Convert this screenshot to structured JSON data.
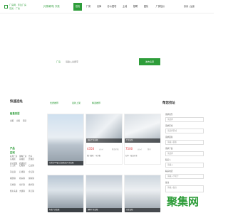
{
  "header": {
    "logo_text": "厂房网 · 专注厂房",
    "logo_sub": "东莞 · 厂房",
    "city": "[切换城市] 东莞",
    "nav": [
      "首页",
      "厂房",
      "仓库",
      "办公居宅",
      "土地",
      "招聘",
      "团队",
      "厂房估价"
    ],
    "active_nav": 0,
    "login": "登录 | 注册"
  },
  "search": {
    "label": "厂房",
    "placeholder": "请输入关键字",
    "button": "发布房源"
  },
  "left": {
    "title": "快速选址",
    "groups": [
      {
        "name": "租售类型",
        "links": [
          "出租",
          "出售",
          "租赁"
        ]
      },
      {
        "name": "产品",
        "links": [
          "标准厂房",
          "钢构厂房",
          "仓库",
          "办公研发",
          "商铺综合"
        ]
      },
      {
        "name": "区域",
        "links": [
          "东城区",
          "南城区",
          "莞城区",
          "万江区",
          "石碣镇",
          "石龙镇",
          "茶山镇",
          "石排镇",
          "企石镇",
          "横沥镇",
          "桥头镇",
          "谢岗镇",
          "东坑镇",
          "常平镇",
          "寮步镇",
          "樟木头镇",
          "大朗镇",
          "黄江镇"
        ]
      }
    ]
  },
  "tabs": [
    "优质推荐",
    "最新上架",
    "精选推荐"
  ],
  "cards_top": [
    {
      "caption": "东莞市XX镇工业园标准厂房出租",
      "price": "",
      "unit": ""
    },
    {
      "caption": "独栋厂房出租",
      "price": "4350",
      "unit": "元/㎡",
      "label": "租金价格",
      "tags": "独门独院 · 可分租"
    },
    {
      "caption": "厂房出售",
      "price": "7500",
      "unit": "元/㎡",
      "label": "售价",
      "tags": "红本 · 双证齐全"
    }
  ],
  "cards_bottom": [
    {
      "caption": "标准厂房出租"
    },
    {
      "caption": "钢构厂房出租"
    },
    {
      "caption": "仓库出租"
    }
  ],
  "right": {
    "title": "帮您找址",
    "fields": [
      {
        "label": "需求类型",
        "value": "请选择"
      },
      {
        "label": "需求区域",
        "value": "请选择区域"
      },
      {
        "label": "需求面积",
        "value": "请输入面积"
      },
      {
        "label": "需求产品",
        "value": "请选择"
      },
      {
        "label": "联系人",
        "value": "请输入"
      },
      {
        "label": "联系电话",
        "value": "请输入手机号"
      },
      {
        "label": "备注",
        "value": "请输入备注"
      }
    ]
  },
  "watermark": "聚集网",
  "colors": {
    "accent": "#2e9d3a",
    "price": "#e4393c"
  }
}
